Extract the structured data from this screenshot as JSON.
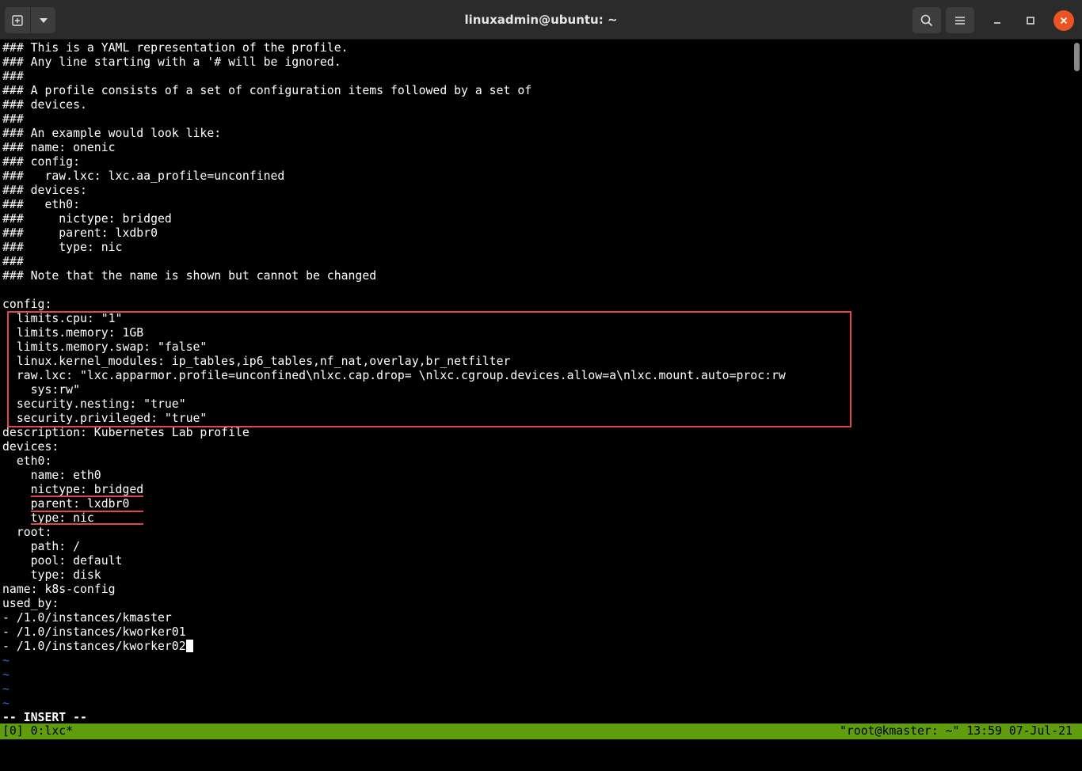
{
  "window": {
    "title": "linuxadmin@ubuntu: ~",
    "icons": {
      "new_tab": "new-tab-icon",
      "dropdown": "chevron-down-icon",
      "search": "search-icon",
      "menu": "hamburger-menu-icon",
      "minimize": "minimize-icon",
      "maximize": "maximize-icon",
      "close": "close-icon"
    },
    "close_color": "#e95420"
  },
  "editor": {
    "lines": [
      "### This is a YAML representation of the profile.",
      "### Any line starting with a '# will be ignored.",
      "###",
      "### A profile consists of a set of configuration items followed by a set of",
      "### devices.",
      "###",
      "### An example would look like:",
      "### name: onenic",
      "### config:",
      "###   raw.lxc: lxc.aa_profile=unconfined",
      "### devices:",
      "###   eth0:",
      "###     nictype: bridged",
      "###     parent: lxdbr0",
      "###     type: nic",
      "###",
      "### Note that the name is shown but cannot be changed",
      "",
      "config:",
      "  limits.cpu: \"1\"",
      "  limits.memory: 1GB",
      "  limits.memory.swap: \"false\"",
      "  linux.kernel_modules: ip_tables,ip6_tables,nf_nat,overlay,br_netfilter",
      "  raw.lxc: \"lxc.apparmor.profile=unconfined\\nlxc.cap.drop= \\nlxc.cgroup.devices.allow=a\\nlxc.mount.auto=proc:rw",
      "    sys:rw\"",
      "  security.nesting: \"true\"",
      "  security.privileged: \"true\"",
      "description: Kubernetes Lab profile",
      "devices:",
      "  eth0:",
      "    name: eth0",
      "    nictype: bridged",
      "    parent: lxdbr0",
      "    type: nic",
      "  root:",
      "    path: /",
      "    pool: default",
      "    type: disk",
      "name: k8s-config",
      "used_by:",
      "- /1.0/instances/kmaster",
      "- /1.0/instances/kworker01",
      "- /1.0/instances/kworker02"
    ],
    "empty_marker": "~",
    "mode": "-- INSERT --",
    "tilde_color": "#3466d9",
    "highlight_color": "#e0464c"
  },
  "tmux": {
    "left": "[0] 0:lxc*",
    "right": "\"root@kmaster: ~\" 13:59 07-Jul-21",
    "color": "#5f9c0e"
  }
}
